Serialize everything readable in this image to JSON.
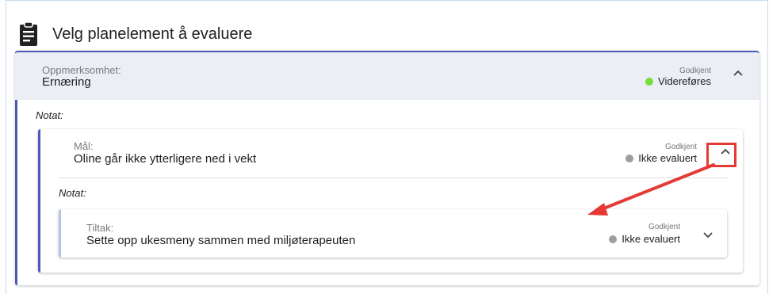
{
  "header": {
    "title": "Velg planelement å evaluere",
    "icon": "clipboard-icon"
  },
  "outer_card": {
    "type_label": "Oppmerksomhet:",
    "name": "Ernæring",
    "approval_label": "Godkjent",
    "status_label": "Videreføres",
    "status_color": "#76dd3c",
    "expanded": true,
    "notat_label": "Notat:"
  },
  "goal_card": {
    "type_label": "Mål:",
    "name": "Oline går ikke ytterligere ned i vekt",
    "approval_label": "Godkjent",
    "status_label": "Ikke evaluert",
    "status_color": "#9e9e9e",
    "expanded": true,
    "notat_label": "Notat:"
  },
  "measure_card": {
    "type_label": "Tiltak:",
    "name": "Sette opp ukesmeny sammen med miljøterapeuten",
    "approval_label": "Godkjent",
    "status_label": "Ikke evaluert",
    "status_color": "#9e9e9e",
    "expanded": false
  },
  "annotation": {
    "color": "#e53935"
  }
}
